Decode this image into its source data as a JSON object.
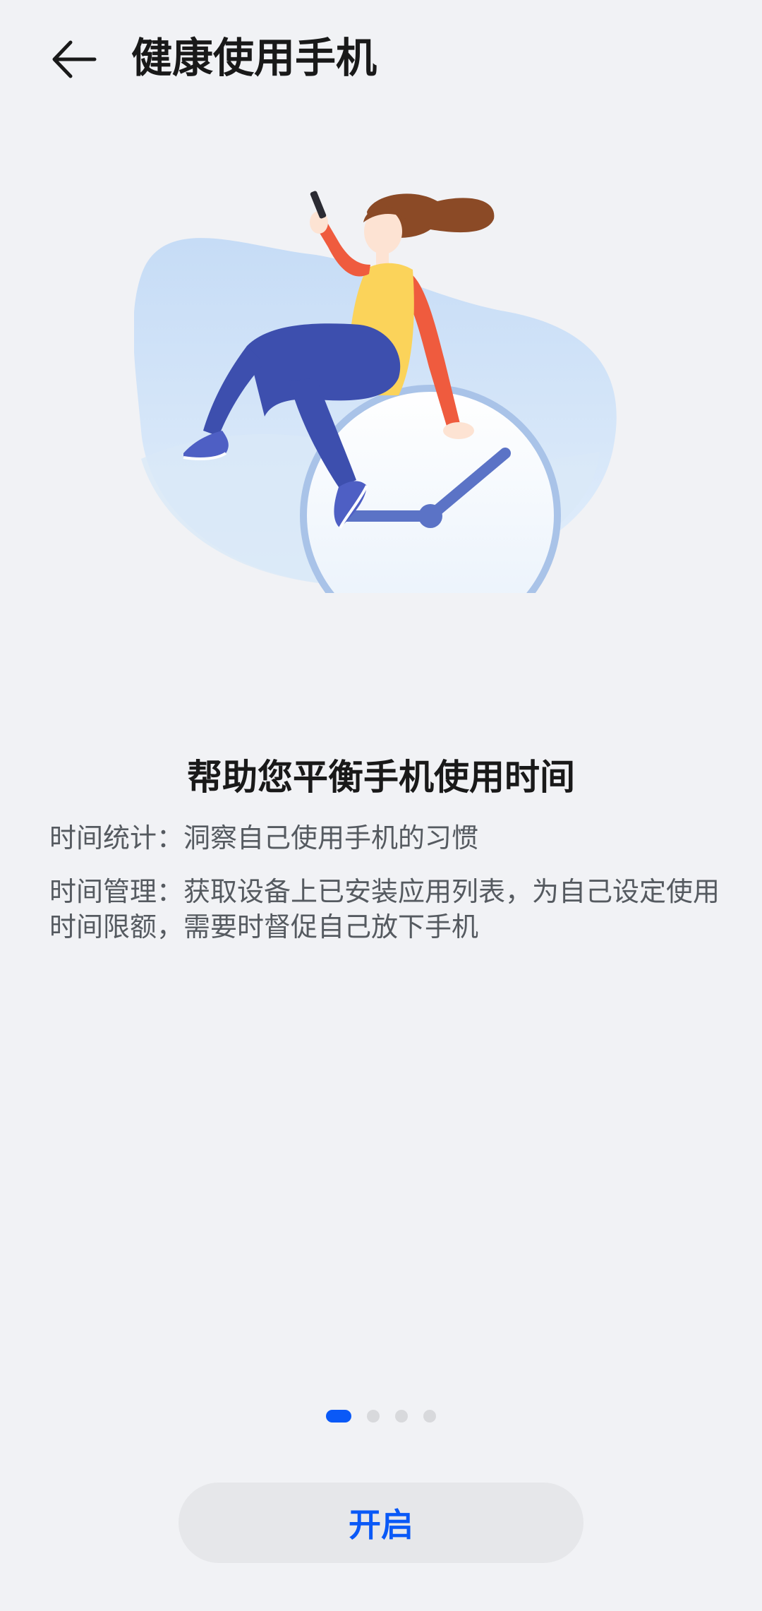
{
  "header": {
    "back_icon": "back-arrow-icon",
    "title": "健康使用手机"
  },
  "illustration": {
    "subject": "woman-sitting-on-clock-illustration"
  },
  "main": {
    "headline": "帮助您平衡手机使用时间",
    "descriptions": [
      "时间统计：洞察自己使用手机的习惯",
      "时间管理：获取设备上已安装应用列表，为自己设定使用时间限额，需要时督促自己放下手机"
    ]
  },
  "pager": {
    "total_pages": 4,
    "current_page": 1
  },
  "actions": {
    "enable_label": "开启"
  },
  "colors": {
    "accent": "#0a59f7",
    "background": "#f1f2f5"
  }
}
